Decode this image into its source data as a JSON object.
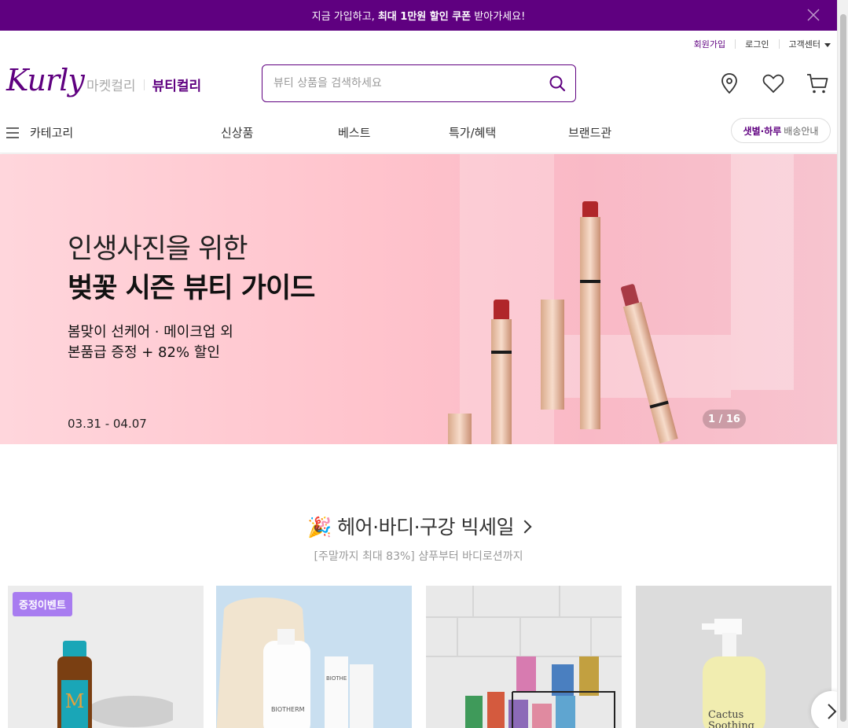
{
  "promo_bar": {
    "text_before": "지금 가입하고, ",
    "text_bold": "최대 1만원 할인 쿠폰",
    "text_after": " 받아가세요!"
  },
  "util_links": {
    "signup": "회원가입",
    "login": "로그인",
    "customer_center": "고객센터"
  },
  "header": {
    "logo": "Kurly",
    "market_tab": "마켓컬리",
    "beauty_tab": "뷰티컬리",
    "search_placeholder": "뷰티 상품을 검색하세요"
  },
  "nav": {
    "category": "카테고리",
    "items": [
      "신상품",
      "베스트",
      "특가/혜택",
      "브랜드관"
    ],
    "delivery_highlight": "샛별·하루",
    "delivery_text": "배송안내"
  },
  "hero": {
    "line1": "인생사진을 위한",
    "line2": "벚꽃 시즌 뷰티 가이드",
    "line3": "봄맞이 선케어 · 메이크업 외",
    "line4": "본품급 증정  + 82%  할인",
    "date": "03.31 - 04.07",
    "counter": "1 / 16"
  },
  "section": {
    "emoji": "🎉",
    "title": "헤어·바디·구강 빅세일",
    "subtitle": "[주말까지 최대 83%] 샴푸부터 바디로션까지"
  },
  "products": [
    {
      "badge": "증정이벤트",
      "bg": "#ececec"
    },
    {
      "badge": "",
      "bg": "#c9dff0"
    },
    {
      "badge": "",
      "bg": "#e9e9e9"
    },
    {
      "badge": "",
      "bg": "#dcdcdc"
    }
  ],
  "colors": {
    "brand": "#5f0080",
    "badge": "#a87cf0"
  }
}
